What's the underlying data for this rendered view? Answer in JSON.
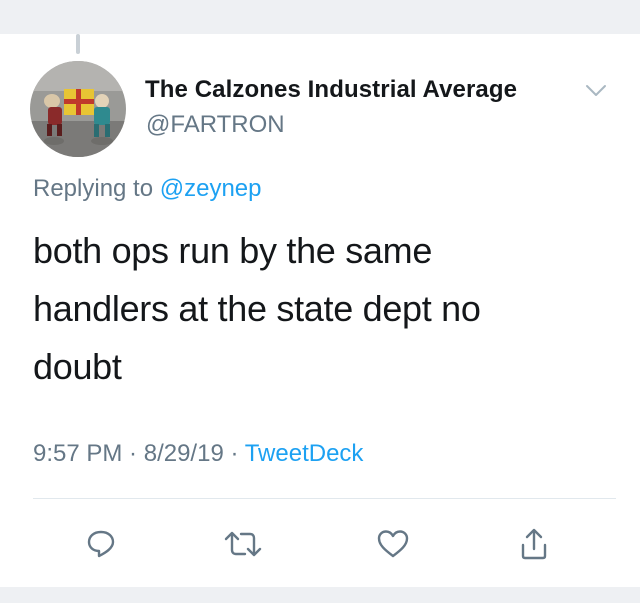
{
  "tweet": {
    "display_name": "The Calzones Industrial Average",
    "handle": "@FARTRON",
    "replying_prefix": "Replying to ",
    "replying_to": "@zeynep",
    "text_lines": [
      "both ops run by the same",
      "handlers at the state dept no",
      "doubt"
    ],
    "time": "9:57 PM",
    "separator": " · ",
    "date": "8/29/19",
    "source": "TweetDeck"
  },
  "actions": [
    {
      "icon": "reply-icon"
    },
    {
      "icon": "retweet-icon"
    },
    {
      "icon": "like-icon"
    },
    {
      "icon": "share-icon"
    }
  ],
  "colors": {
    "accent": "#1da1f2",
    "secondary_text": "#657786",
    "primary_text": "#14171a",
    "icon": "#657786",
    "band": "#eef0f3"
  }
}
